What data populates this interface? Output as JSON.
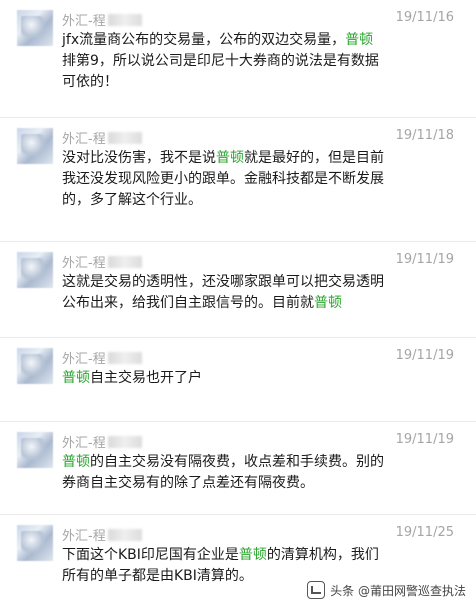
{
  "messages": [
    {
      "name_prefix": "外汇-程",
      "name_tail": "",
      "time": "19/11/16",
      "lines": [
        [
          {
            "t": "jfx流量商公布的交易量，公布的双边交易量，"
          },
          {
            "t": "普顿",
            "hl": true
          }
        ],
        [
          {
            "t": "排第9，所以说公司是印尼十大券商的说法是有数据"
          }
        ],
        [
          {
            "t": "可依的！"
          }
        ]
      ]
    },
    {
      "name_prefix": "外汇-程",
      "name_tail": "",
      "time": "19/11/18",
      "lines": [
        [
          {
            "t": "没对比没伤害，我不是说"
          },
          {
            "t": "普顿",
            "hl": true
          },
          {
            "t": "就是最好的，但是目前"
          }
        ],
        [
          {
            "t": "我还没发现风险更小的跟单。金融科技都是不断发展"
          }
        ],
        [
          {
            "t": "的，多了解这个行业。"
          }
        ]
      ]
    },
    {
      "name_prefix": "外汇-程",
      "name_tail": "",
      "time": "19/11/19",
      "lines": [
        [
          {
            "t": "这就是交易的透明性，还没哪家跟单可以把交易透明"
          }
        ],
        [
          {
            "t": "公布出来，给我们自主跟信号的。目前就"
          },
          {
            "t": "普顿",
            "hl": true
          }
        ]
      ]
    },
    {
      "name_prefix": "外汇-程",
      "name_tail": "",
      "time": "19/11/19",
      "lines": [
        [
          {
            "t": "普顿",
            "hl": true
          },
          {
            "t": "自主交易也开了户"
          }
        ]
      ]
    },
    {
      "name_prefix": "外汇-程",
      "name_tail": "",
      "time": "19/11/19",
      "lines": [
        [
          {
            "t": "普顿",
            "hl": true
          },
          {
            "t": "的自主交易没有隔夜费，收点差和手续费。别的"
          }
        ],
        [
          {
            "t": "券商自主交易有的除了点差还有隔夜费。"
          }
        ]
      ]
    },
    {
      "name_prefix": "外汇-程",
      "name_tail": "",
      "time": "19/11/25",
      "lines": [
        [
          {
            "t": "下面这个KBI印尼国有企业是"
          },
          {
            "t": "普顿",
            "hl": true
          },
          {
            "t": "的清算机构，我们"
          }
        ],
        [
          {
            "t": "所有的单子都是由KBI清算的。"
          }
        ]
      ]
    }
  ],
  "watermark": {
    "text": "头条 @莆田网警巡查执法"
  },
  "colors": {
    "highlight": "#2ba52e",
    "meta": "#a5a5a5",
    "text": "#1a1a1a"
  },
  "icons": {
    "watermark": "toutiao-logo-icon"
  }
}
